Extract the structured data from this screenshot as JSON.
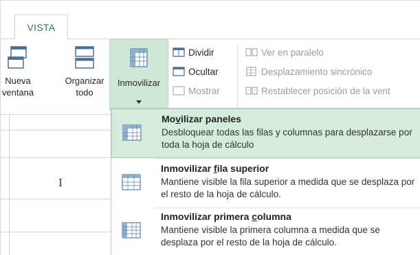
{
  "ribbon": {
    "tab_label": "VISTA",
    "nueva_ventana": {
      "line1": "Nueva",
      "line2": "ventana"
    },
    "organizar_todo": {
      "line1": "Organizar",
      "line2": "todo"
    },
    "inmovilizar": {
      "label": "Inmovilizar"
    },
    "dividir": "Dividir",
    "ocultar": "Ocultar",
    "mostrar": "Mostrar",
    "ver_paralelo": "Ver en paralelo",
    "desplazamiento": "Desplazamiento sincrónico",
    "restablecer": "Restablecer posición de la vent"
  },
  "grid": {
    "cursor": "I"
  },
  "menu": {
    "items": [
      {
        "title_pre": "Mo",
        "title_key": "v",
        "title_post": "ilizar paneles",
        "desc": "Desbloquear todas las filas y columnas para desplazarse por toda la hoja de cálculo",
        "highlighted": true
      },
      {
        "title_pre": "Inmovilizar ",
        "title_key": "f",
        "title_post": "ila superior",
        "desc": "Mantiene visible la fila superior a medida que se desplaza por el resto de la hoja de cálculo."
      },
      {
        "title_pre": "Inmovilizar primera ",
        "title_key": "c",
        "title_post": "olumna",
        "desc": "Mantiene visible la primera columna a medida que se desplaza por el resto de la hoja de cálculo."
      }
    ]
  },
  "colors": {
    "accent_green": "#2e7d46",
    "highlight": "#d6ecdb",
    "button_pressed": "#cfe8d5"
  },
  "icons": {
    "nueva_ventana": "new-window-icon",
    "organizar_todo": "arrange-all-icon",
    "inmovilizar": "freeze-panes-icon",
    "dividir": "split-icon",
    "ocultar": "hide-icon",
    "mostrar": "unhide-icon",
    "ver_paralelo": "side-by-side-icon",
    "desplazamiento": "sync-scroll-icon",
    "restablecer": "reset-window-icon"
  }
}
